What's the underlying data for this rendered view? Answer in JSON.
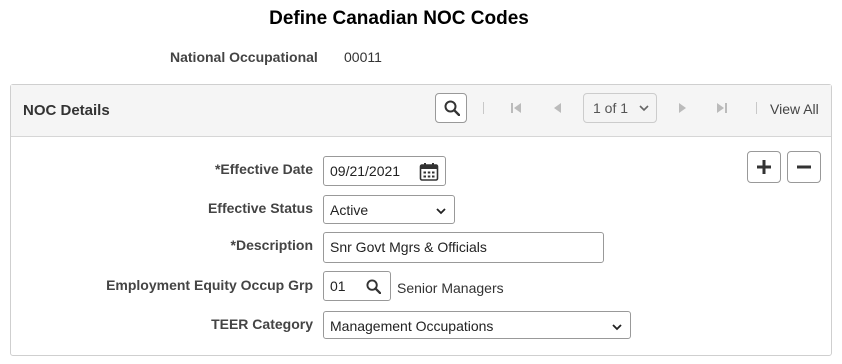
{
  "page": {
    "title": "Define Canadian NOC Codes",
    "national_occupational_label": "National Occupational",
    "national_occupational_value": "00011"
  },
  "panel": {
    "title": "NOC Details",
    "pager_text": "1 of 1",
    "view_all": "View All"
  },
  "form": {
    "effective_date_label": "*Effective Date",
    "effective_date_value": "09/21/2021",
    "effective_status_label": "Effective Status",
    "effective_status_value": "Active",
    "description_label": "*Description",
    "description_value": "Snr Govt Mgrs & Officials",
    "ee_group_label": "Employment Equity Occup Grp",
    "ee_group_value": "01",
    "ee_group_description": "Senior Managers",
    "teer_label": "TEER Category",
    "teer_value": "Management Occupations"
  },
  "icons": [
    "search-icon",
    "first-page-icon",
    "previous-page-icon",
    "chevron-down-icon",
    "next-page-icon",
    "last-page-icon",
    "calendar-icon",
    "lookup-icon",
    "add-icon",
    "remove-icon"
  ],
  "colors": {
    "header_bg": "#f5f5f5",
    "border": "#999999",
    "text": "#333333"
  }
}
